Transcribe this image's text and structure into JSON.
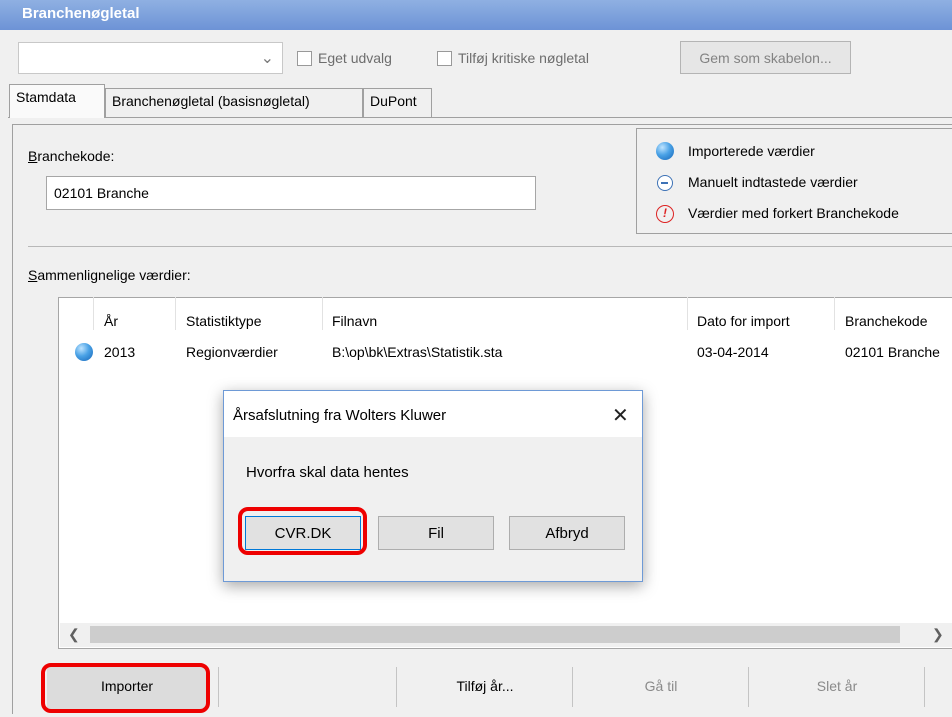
{
  "window": {
    "title": "Branchenøgletal"
  },
  "toolbar": {
    "combo_value": "",
    "eget_udvalg": "Eget udvalg",
    "tilfoej_kritiske": "Tilføj kritiske nøgletal",
    "gem_skabelon": "Gem som skabelon..."
  },
  "tabs": [
    {
      "label": "Stamdata",
      "active": true
    },
    {
      "label": "Branchenøgletal (basisnøgletal)",
      "active": false
    },
    {
      "label": "DuPont",
      "active": false
    }
  ],
  "form": {
    "branchekode_label_prefix": "B",
    "branchekode_label_rest": "ranchekode:",
    "branchekode_value": "02101 Branche"
  },
  "legend": {
    "imported": "Importerede værdier",
    "manual": "Manuelt indtastede værdier",
    "wrong": "Værdier med forkert Branchekode"
  },
  "list": {
    "label_prefix": "S",
    "label_rest": "ammenlignelige værdier:",
    "columns": [
      "År",
      "Statistiktype",
      "Filnavn",
      "Dato for import",
      "Branchekode"
    ],
    "rows": [
      {
        "year": "2013",
        "type": "Regionværdier",
        "file": "B:\\op\\bk\\Extras\\Statistik.sta",
        "date": "03-04-2014",
        "code": "02101 Branche"
      }
    ]
  },
  "dialog": {
    "title": "Årsafslutning fra Wolters Kluwer",
    "message": "Hvorfra skal data hentes",
    "buttons": {
      "cvr": "CVR.DK",
      "fil": "Fil",
      "afbryd": "Afbryd"
    }
  },
  "bottom_buttons": {
    "importer": "Importer",
    "tilfoej_aar": "Tilføj år...",
    "gaa_til": "Gå til",
    "slet_aar": "Slet år"
  },
  "colors": {
    "highlight": "#ee0000",
    "title_bar": "#7a9edb"
  }
}
